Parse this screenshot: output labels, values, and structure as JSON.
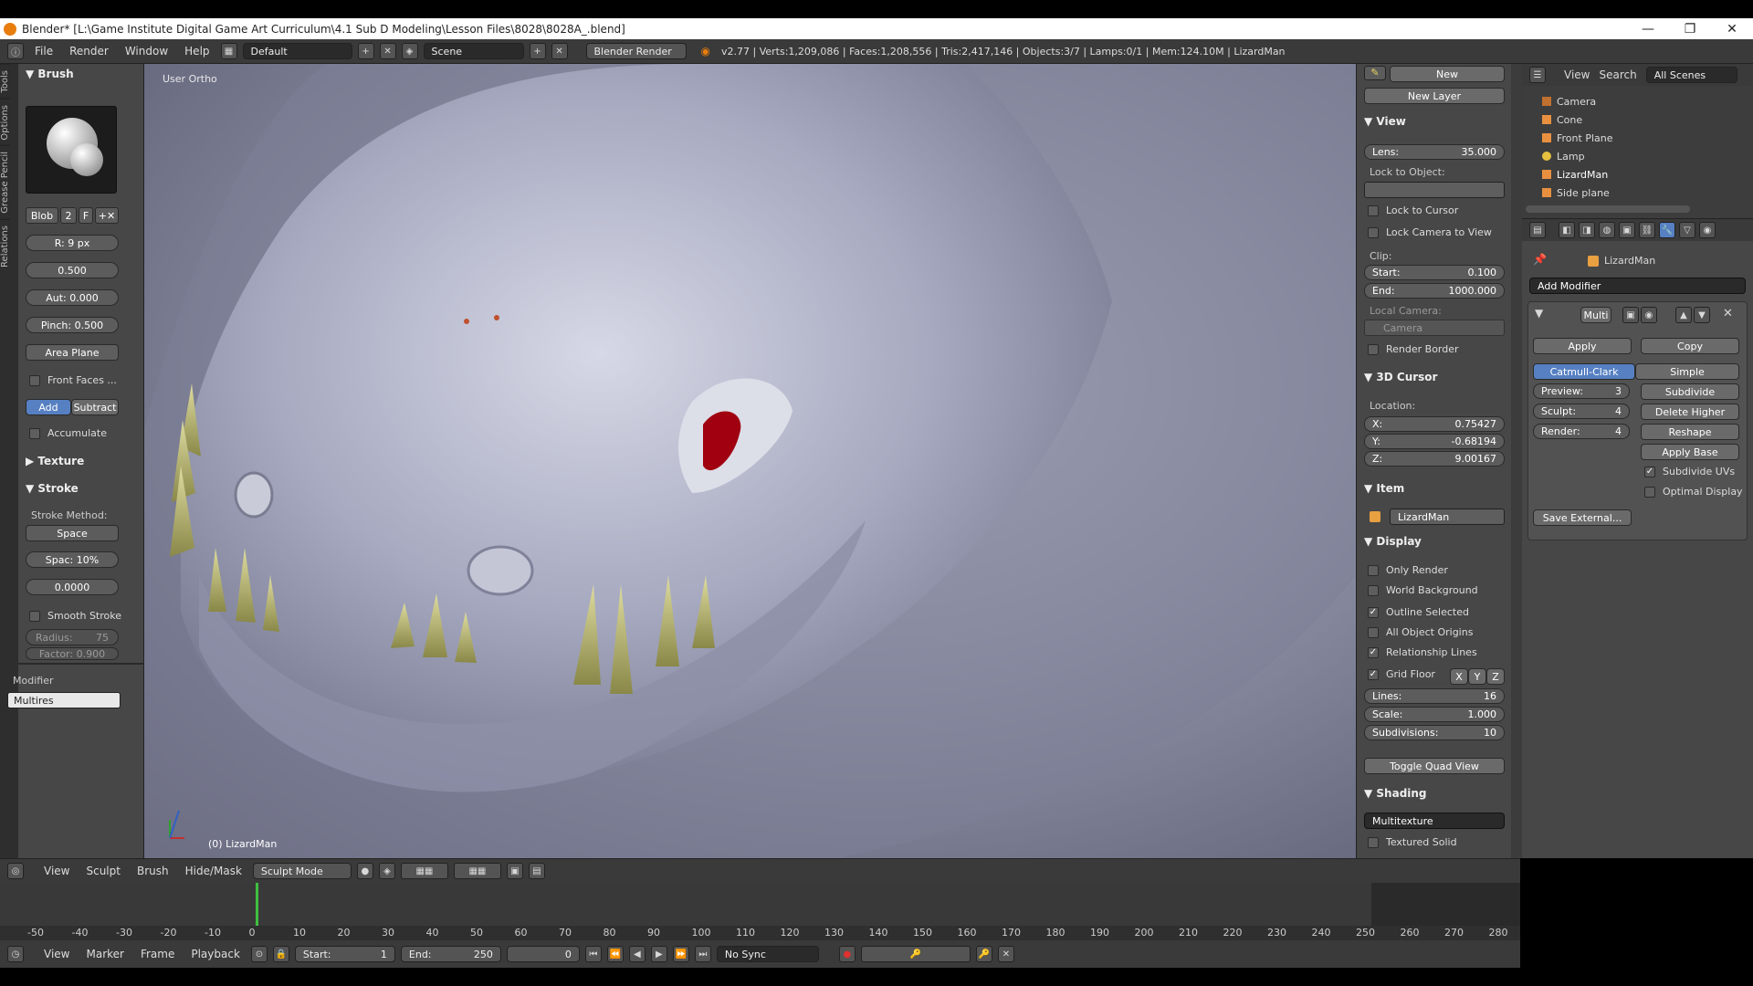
{
  "window": {
    "title": "Blender* [L:\\Game Institute Digital Game Art  Curriculum\\4.1 Sub D Modeling\\Lesson Files\\8028\\8028A_.blend]",
    "minimize": "—",
    "maximize": "❐",
    "close": "✕"
  },
  "menu": {
    "file": "File",
    "render": "Render",
    "window": "Window",
    "help": "Help"
  },
  "screen_layout": "Default",
  "scene": "Scene",
  "render_engine": "Blender Render",
  "stats": "v2.77 | Verts:1,209,086 | Faces:1,208,556 | Tris:2,417,146 | Objects:3/7 | Lamps:0/1 | Mem:124.10M | LizardMan",
  "tool_tabs": [
    "Tools",
    "Options",
    "Grease Pencil",
    "Relations"
  ],
  "brush": {
    "header": "Brush",
    "name": "Blob",
    "users": "2",
    "fake": "F",
    "radius": "R: 9 px",
    "strength": "0.500",
    "autosmooth": "Aut: 0.000",
    "pinch": "Pinch:",
    "pinch_val": "0.500",
    "plane": "Area Plane",
    "front_faces": "Front Faces ...",
    "add": "Add",
    "subtract": "Subtract",
    "accumulate": "Accumulate",
    "texture": "Texture",
    "stroke": "Stroke",
    "stroke_method": "Stroke Method:",
    "method": "Space",
    "spacing": "Spac: 10%",
    "jitter": "0.0000",
    "smooth_stroke": "Smooth Stroke",
    "radius_label": "Radius:",
    "radius_val": "75",
    "factor": "Factor: 0.900"
  },
  "modifier": {
    "label": "Modifier",
    "name": "Multires"
  },
  "viewport": {
    "view_name": "User Ortho",
    "object_label": "(0) LizardMan"
  },
  "rp": {
    "new": "New",
    "new_layer": "New Layer",
    "view": "View",
    "lens": "Lens:",
    "lens_val": "35.000",
    "lock_object": "Lock to Object:",
    "lock_cursor": "Lock to Cursor",
    "lock_camera": "Lock Camera to View",
    "clip": "Clip:",
    "start": "Start:",
    "start_val": "0.100",
    "end": "End:",
    "end_val": "1000.000",
    "local_camera": "Local Camera:",
    "camera": "Camera",
    "render_border": "Render Border",
    "cursor": "3D Cursor",
    "location": "Location:",
    "x": "X:",
    "x_val": "0.75427",
    "y": "Y:",
    "y_val": "-0.68194",
    "z": "Z:",
    "z_val": "9.00167",
    "item": "Item",
    "item_name": "LizardMan",
    "display": "Display",
    "only_render": "Only Render",
    "world_bg": "World Background",
    "outline": "Outline Selected",
    "all_origins": "All Object Origins",
    "rel_lines": "Relationship Lines",
    "grid_floor": "Grid Floor",
    "gx": "X",
    "gy": "Y",
    "gz": "Z",
    "lines": "Lines:",
    "lines_val": "16",
    "scale": "Scale:",
    "scale_val": "1.000",
    "subdiv": "Subdivisions:",
    "subdiv_val": "10",
    "quad": "Toggle Quad View",
    "shading": "Shading",
    "multitexture": "Multitexture",
    "textured_solid": "Textured Solid"
  },
  "outliner": {
    "view": "View",
    "search": "Search",
    "filter": "All Scenes",
    "items": [
      "Camera",
      "Cone",
      "Front Plane",
      "Lamp",
      "LizardMan",
      "Side plane"
    ]
  },
  "props": {
    "object": "LizardMan",
    "add_modifier": "Add Modifier",
    "mod_name": "Multi",
    "apply": "Apply",
    "copy": "Copy",
    "catmull": "Catmull-Clark",
    "simple": "Simple",
    "preview": "Preview:",
    "preview_val": "3",
    "sculpt": "Sculpt:",
    "sculpt_val": "4",
    "render": "Render:",
    "render_val": "4",
    "subdivide": "Subdivide",
    "delete_higher": "Delete Higher",
    "reshape": "Reshape",
    "apply_base": "Apply Base",
    "subdivide_uvs": "Subdivide UVs",
    "optimal": "Optimal Display",
    "save_external": "Save External..."
  },
  "vpheader": {
    "view": "View",
    "sculpt": "Sculpt",
    "brush": "Brush",
    "hidemask": "Hide/Mask",
    "mode": "Sculpt Mode"
  },
  "ruler": [
    "-50",
    "-40",
    "-30",
    "-20",
    "-10",
    "0",
    "10",
    "20",
    "30",
    "40",
    "50",
    "60",
    "70",
    "80",
    "90",
    "100",
    "110",
    "120",
    "130",
    "140",
    "150",
    "160",
    "170",
    "180",
    "190",
    "200",
    "210",
    "220",
    "230",
    "240",
    "250",
    "260",
    "270",
    "280"
  ],
  "tl": {
    "view": "View",
    "marker": "Marker",
    "frame": "Frame",
    "playback": "Playback",
    "start": "Start:",
    "start_val": "1",
    "end": "End:",
    "end_val": "250",
    "current": "0",
    "sync": "No Sync"
  },
  "colors": {
    "accent": "#5680c2",
    "eye": "#a00010",
    "teeth": "#a9a86a",
    "skin": "#aeb1c6"
  }
}
